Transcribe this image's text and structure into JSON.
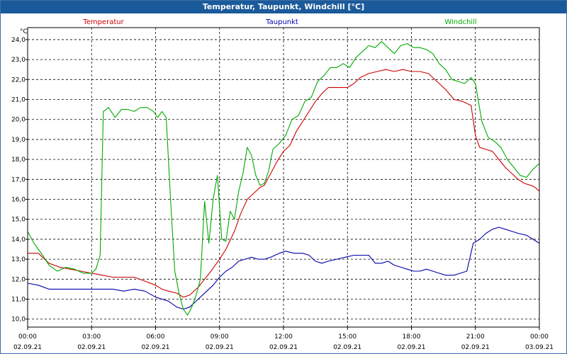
{
  "window": {
    "title": "Temperatur, Taupunkt, Windchill [°C]"
  },
  "chart_data": {
    "type": "line",
    "title": "Temperatur, Taupunkt, Windchill [°C]",
    "ylabel": "°C",
    "ylim": [
      9.6,
      24.6
    ],
    "yticks": [
      "10,0",
      "11,0",
      "12,0",
      "13,0",
      "14,0",
      "15,0",
      "16,0",
      "17,0",
      "18,0",
      "19,0",
      "20,0",
      "21,0",
      "22,0",
      "23,0",
      "24,0"
    ],
    "xlim": [
      0,
      24
    ],
    "xticks": [
      {
        "x": 0,
        "time": "00:00",
        "date": "02.09.21"
      },
      {
        "x": 3,
        "time": "03:00",
        "date": "02.09.21"
      },
      {
        "x": 6,
        "time": "06:00",
        "date": "02.09.21"
      },
      {
        "x": 9,
        "time": "09:00",
        "date": "02.09.21"
      },
      {
        "x": 12,
        "time": "12:00",
        "date": "02.09.21"
      },
      {
        "x": 15,
        "time": "15:00",
        "date": "02.09.21"
      },
      {
        "x": 18,
        "time": "18:00",
        "date": "02.09.21"
      },
      {
        "x": 21,
        "time": "21:00",
        "date": "02.09.21"
      },
      {
        "x": 24,
        "time": "00:00",
        "date": "03.09.21"
      }
    ],
    "grid": true,
    "legend_position": "top",
    "series": [
      {
        "name": "Temperatur",
        "color": "#cc0000",
        "points": [
          [
            0,
            13.3
          ],
          [
            0.5,
            13.3
          ],
          [
            1,
            12.8
          ],
          [
            1.5,
            12.6
          ],
          [
            2,
            12.5
          ],
          [
            2.5,
            12.4
          ],
          [
            3,
            12.3
          ],
          [
            3.5,
            12.2
          ],
          [
            4,
            12.1
          ],
          [
            4.5,
            12.1
          ],
          [
            5,
            12.1
          ],
          [
            5.5,
            11.9
          ],
          [
            6,
            11.7
          ],
          [
            6.3,
            11.5
          ],
          [
            6.6,
            11.4
          ],
          [
            7,
            11.3
          ],
          [
            7.3,
            11.1
          ],
          [
            7.6,
            11.2
          ],
          [
            8,
            11.6
          ],
          [
            8.3,
            12.0
          ],
          [
            8.6,
            12.4
          ],
          [
            9,
            13.0
          ],
          [
            9.3,
            13.5
          ],
          [
            9.7,
            14.4
          ],
          [
            10,
            15.3
          ],
          [
            10.3,
            16.0
          ],
          [
            10.6,
            16.3
          ],
          [
            10.9,
            16.6
          ],
          [
            11.1,
            16.7
          ],
          [
            11.4,
            17.3
          ],
          [
            11.7,
            17.9
          ],
          [
            12,
            18.4
          ],
          [
            12.3,
            18.7
          ],
          [
            12.6,
            19.4
          ],
          [
            12.9,
            19.9
          ],
          [
            13.2,
            20.4
          ],
          [
            13.5,
            20.9
          ],
          [
            13.8,
            21.3
          ],
          [
            14.1,
            21.6
          ],
          [
            14.4,
            21.6
          ],
          [
            14.7,
            21.6
          ],
          [
            15,
            21.6
          ],
          [
            15.3,
            21.8
          ],
          [
            15.6,
            22.1
          ],
          [
            16,
            22.3
          ],
          [
            16.4,
            22.4
          ],
          [
            16.8,
            22.5
          ],
          [
            17.2,
            22.4
          ],
          [
            17.6,
            22.5
          ],
          [
            18,
            22.4
          ],
          [
            18.4,
            22.4
          ],
          [
            18.8,
            22.3
          ],
          [
            19.2,
            21.9
          ],
          [
            19.6,
            21.5
          ],
          [
            20,
            21.0
          ],
          [
            20.4,
            20.9
          ],
          [
            20.8,
            20.7
          ],
          [
            21,
            19.2
          ],
          [
            21.2,
            18.6
          ],
          [
            21.5,
            18.5
          ],
          [
            21.8,
            18.4
          ],
          [
            22.1,
            18.0
          ],
          [
            22.4,
            17.6
          ],
          [
            22.7,
            17.3
          ],
          [
            23,
            17.0
          ],
          [
            23.3,
            16.8
          ],
          [
            23.6,
            16.7
          ],
          [
            23.8,
            16.6
          ],
          [
            24,
            16.4
          ]
        ]
      },
      {
        "name": "Taupunkt",
        "color": "#0000aa",
        "points": [
          [
            0,
            11.8
          ],
          [
            0.5,
            11.7
          ],
          [
            1,
            11.5
          ],
          [
            1.5,
            11.5
          ],
          [
            2,
            11.5
          ],
          [
            2.5,
            11.5
          ],
          [
            3,
            11.5
          ],
          [
            3.5,
            11.5
          ],
          [
            4,
            11.5
          ],
          [
            4.5,
            11.4
          ],
          [
            5,
            11.5
          ],
          [
            5.5,
            11.4
          ],
          [
            6,
            11.1
          ],
          [
            6.3,
            11.0
          ],
          [
            6.6,
            10.9
          ],
          [
            7,
            10.6
          ],
          [
            7.3,
            10.5
          ],
          [
            7.6,
            10.6
          ],
          [
            8,
            11.0
          ],
          [
            8.4,
            11.4
          ],
          [
            8.7,
            11.7
          ],
          [
            9,
            12.1
          ],
          [
            9.3,
            12.4
          ],
          [
            9.6,
            12.6
          ],
          [
            9.9,
            12.9
          ],
          [
            10.2,
            13.0
          ],
          [
            10.5,
            13.1
          ],
          [
            10.8,
            13.0
          ],
          [
            11.1,
            13.0
          ],
          [
            11.4,
            13.1
          ],
          [
            11.8,
            13.3
          ],
          [
            12.1,
            13.4
          ],
          [
            12.5,
            13.3
          ],
          [
            12.9,
            13.3
          ],
          [
            13.2,
            13.2
          ],
          [
            13.5,
            12.9
          ],
          [
            13.8,
            12.8
          ],
          [
            14.1,
            12.9
          ],
          [
            14.5,
            13.0
          ],
          [
            14.9,
            13.1
          ],
          [
            15.3,
            13.2
          ],
          [
            15.7,
            13.2
          ],
          [
            16,
            13.2
          ],
          [
            16.3,
            12.8
          ],
          [
            16.6,
            12.8
          ],
          [
            16.9,
            12.9
          ],
          [
            17.2,
            12.7
          ],
          [
            17.5,
            12.6
          ],
          [
            17.8,
            12.5
          ],
          [
            18.1,
            12.4
          ],
          [
            18.4,
            12.4
          ],
          [
            18.7,
            12.5
          ],
          [
            19,
            12.4
          ],
          [
            19.3,
            12.3
          ],
          [
            19.6,
            12.2
          ],
          [
            20,
            12.2
          ],
          [
            20.3,
            12.3
          ],
          [
            20.6,
            12.4
          ],
          [
            20.9,
            13.8
          ],
          [
            21.2,
            14.0
          ],
          [
            21.5,
            14.3
          ],
          [
            21.8,
            14.5
          ],
          [
            22.1,
            14.6
          ],
          [
            22.4,
            14.5
          ],
          [
            22.7,
            14.4
          ],
          [
            23,
            14.3
          ],
          [
            23.4,
            14.2
          ],
          [
            23.7,
            14.0
          ],
          [
            24,
            13.8
          ]
        ]
      },
      {
        "name": "Windchill",
        "color": "#00aa00",
        "points": [
          [
            0,
            14.4
          ],
          [
            0.3,
            13.8
          ],
          [
            0.7,
            13.2
          ],
          [
            1,
            12.7
          ],
          [
            1.4,
            12.4
          ],
          [
            1.8,
            12.6
          ],
          [
            2.2,
            12.5
          ],
          [
            2.6,
            12.3
          ],
          [
            3,
            12.3
          ],
          [
            3.2,
            12.5
          ],
          [
            3.4,
            13.2
          ],
          [
            3.55,
            20.4
          ],
          [
            3.8,
            20.6
          ],
          [
            4.1,
            20.1
          ],
          [
            4.4,
            20.5
          ],
          [
            4.7,
            20.5
          ],
          [
            5,
            20.4
          ],
          [
            5.3,
            20.6
          ],
          [
            5.6,
            20.6
          ],
          [
            5.9,
            20.4
          ],
          [
            6.1,
            20.1
          ],
          [
            6.3,
            20.4
          ],
          [
            6.5,
            20.1
          ],
          [
            6.7,
            16.0
          ],
          [
            6.9,
            12.4
          ],
          [
            7.1,
            11.3
          ],
          [
            7.3,
            10.5
          ],
          [
            7.5,
            10.2
          ],
          [
            7.7,
            10.6
          ],
          [
            7.9,
            11.2
          ],
          [
            8.1,
            12.0
          ],
          [
            8.3,
            15.9
          ],
          [
            8.5,
            13.8
          ],
          [
            8.7,
            16.0
          ],
          [
            8.9,
            17.2
          ],
          [
            9.1,
            14.0
          ],
          [
            9.3,
            13.9
          ],
          [
            9.5,
            15.4
          ],
          [
            9.7,
            15.0
          ],
          [
            9.9,
            16.4
          ],
          [
            10.1,
            17.3
          ],
          [
            10.3,
            18.6
          ],
          [
            10.5,
            18.2
          ],
          [
            10.7,
            17.2
          ],
          [
            10.9,
            16.7
          ],
          [
            11.1,
            16.8
          ],
          [
            11.3,
            17.4
          ],
          [
            11.5,
            18.5
          ],
          [
            11.8,
            18.8
          ],
          [
            12.1,
            19.2
          ],
          [
            12.4,
            20.0
          ],
          [
            12.7,
            20.2
          ],
          [
            13,
            20.9
          ],
          [
            13.3,
            21.1
          ],
          [
            13.6,
            21.9
          ],
          [
            13.9,
            22.2
          ],
          [
            14.2,
            22.6
          ],
          [
            14.5,
            22.6
          ],
          [
            14.8,
            22.8
          ],
          [
            15.1,
            22.6
          ],
          [
            15.4,
            23.1
          ],
          [
            15.7,
            23.4
          ],
          [
            16,
            23.7
          ],
          [
            16.3,
            23.6
          ],
          [
            16.6,
            23.9
          ],
          [
            16.9,
            23.6
          ],
          [
            17.2,
            23.3
          ],
          [
            17.5,
            23.7
          ],
          [
            17.8,
            23.8
          ],
          [
            18.1,
            23.6
          ],
          [
            18.4,
            23.6
          ],
          [
            18.7,
            23.5
          ],
          [
            19,
            23.3
          ],
          [
            19.3,
            22.8
          ],
          [
            19.6,
            22.5
          ],
          [
            19.9,
            22.0
          ],
          [
            20.2,
            21.9
          ],
          [
            20.5,
            21.8
          ],
          [
            20.8,
            22.1
          ],
          [
            21.0,
            21.8
          ],
          [
            21.3,
            19.9
          ],
          [
            21.6,
            19.1
          ],
          [
            21.9,
            18.9
          ],
          [
            22.2,
            18.6
          ],
          [
            22.5,
            18.0
          ],
          [
            22.8,
            17.6
          ],
          [
            23.1,
            17.2
          ],
          [
            23.4,
            17.1
          ],
          [
            23.7,
            17.5
          ],
          [
            24,
            17.8
          ]
        ]
      }
    ]
  }
}
